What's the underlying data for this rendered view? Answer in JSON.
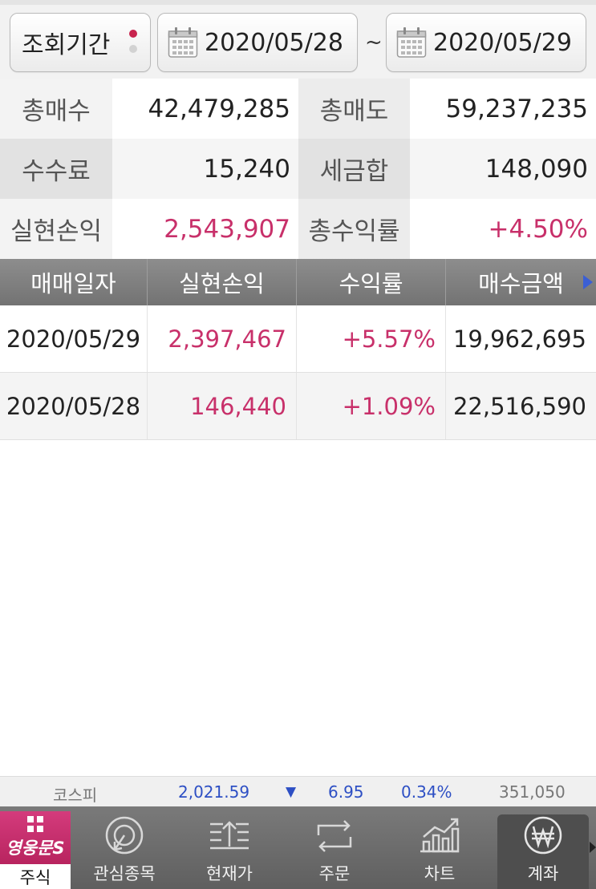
{
  "header": {
    "period_label": "조회기간",
    "date_from": "2020/05/28",
    "separator": "~",
    "date_to": "2020/05/29"
  },
  "summary": {
    "total_buy_label": "총매수",
    "total_buy": "42,479,285",
    "total_sell_label": "총매도",
    "total_sell": "59,237,235",
    "fee_label": "수수료",
    "fee": "15,240",
    "tax_label": "세금합",
    "tax": "148,090",
    "realized_pl_label": "실현손익",
    "realized_pl": "2,543,907",
    "total_return_label": "총수익률",
    "total_return": "+4.50%"
  },
  "table": {
    "columns": [
      "매매일자",
      "실현손익",
      "수익률",
      "매수금액"
    ],
    "rows": [
      {
        "date": "2020/05/29",
        "pl": "2,397,467",
        "rate": "+5.57%",
        "buy_amount": "19,962,695"
      },
      {
        "date": "2020/05/28",
        "pl": "146,440",
        "rate": "+1.09%",
        "buy_amount": "22,516,590"
      }
    ]
  },
  "ticker": {
    "name": "코스피",
    "index": "2,021.59",
    "direction": "▼",
    "change": "6.95",
    "rate": "0.34%",
    "volume": "351,050"
  },
  "nav": {
    "brand_logo": "영웅문S",
    "stock": "주식",
    "watchlist": "관심종목",
    "price": "현재가",
    "order": "주문",
    "chart": "차트",
    "account": "계좌",
    "active": "account"
  },
  "colors": {
    "accent": "#c8306a",
    "down": "#2d4fc4",
    "brand": "#c42c6a"
  }
}
